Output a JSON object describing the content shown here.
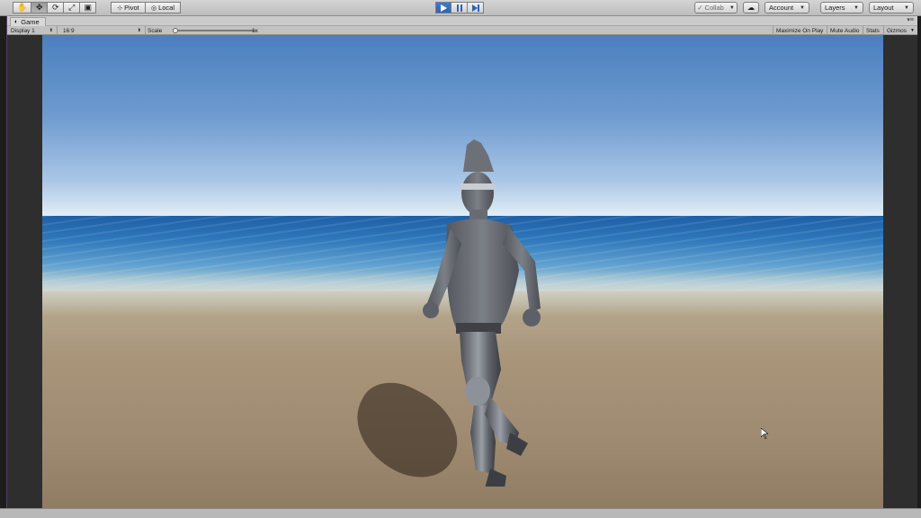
{
  "toolbar": {
    "transform_tools": [
      {
        "name": "hand-tool",
        "icon": "hand-icon",
        "glyph": "✋",
        "active": false
      },
      {
        "name": "move-tool",
        "icon": "move-icon",
        "glyph": "✥",
        "active": true
      },
      {
        "name": "rotate-tool",
        "icon": "rotate-icon",
        "glyph": "⟳",
        "active": false
      },
      {
        "name": "scale-tool",
        "icon": "scale-icon",
        "glyph": "⤢",
        "active": false
      },
      {
        "name": "rect-tool",
        "icon": "rect-icon",
        "glyph": "▣",
        "active": false
      }
    ],
    "pivot_label": "Pivot",
    "local_label": "Local",
    "play_active": true,
    "collab_label": "Collab",
    "account_label": "Account",
    "layers_label": "Layers",
    "layout_label": "Layout"
  },
  "game_view": {
    "tab_title": "Game",
    "display_value": "Display 1",
    "aspect_value": "16:9",
    "scale_label": "Scale",
    "scale_value": "1x",
    "maximize_on_play": "Maximize On Play",
    "mute_audio": "Mute Audio",
    "stats": "Stats",
    "gizmos": "Gizmos"
  },
  "colors": {
    "play_accent": "#2c63b8",
    "editor_chrome": "#c2c2c2",
    "sky_top": "#4a7fbe",
    "sea": "#2f78bb",
    "sand": "#a8957a"
  }
}
